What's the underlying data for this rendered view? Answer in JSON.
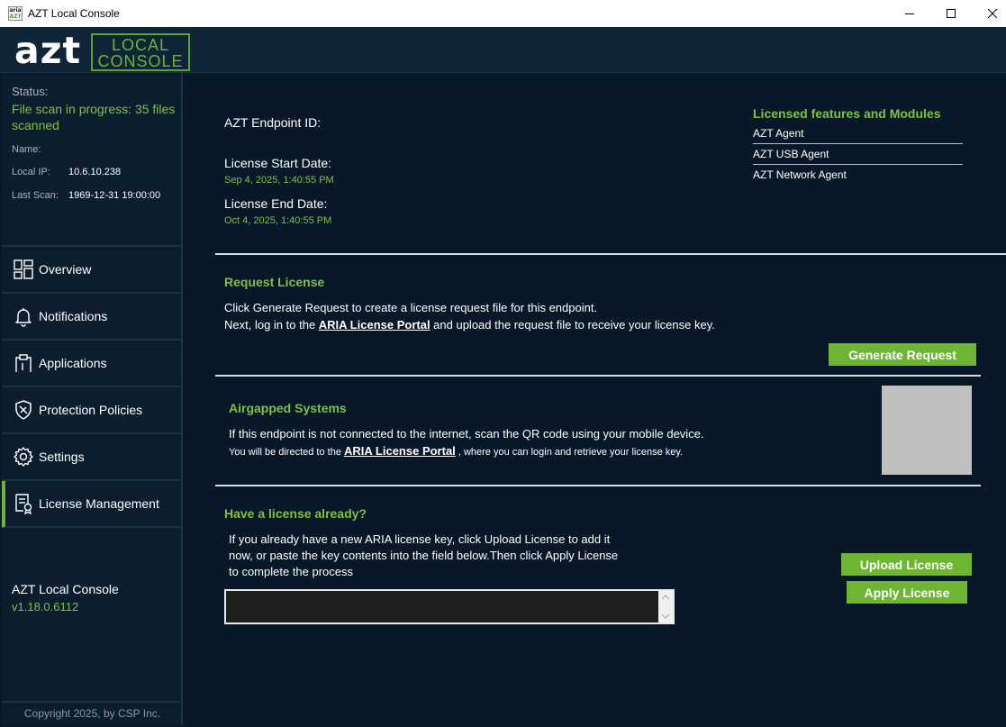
{
  "window": {
    "title": "AZT Local Console",
    "icon_text_top": "aria",
    "icon_text_bottom": "AZT"
  },
  "logo": {
    "main": "azt",
    "line1": "LOCAL",
    "line2": "CONSOLE",
    "accent_color": "#6eb534"
  },
  "status": {
    "status_label": "Status:",
    "status_text": "File scan in progress: 35 files scanned",
    "name_label": "Name:",
    "name_value": "",
    "ip_label": "Local IP:",
    "ip_value": "10.6.10.238",
    "last_scan_label": "Last Scan:",
    "last_scan_value": "1969-12-31 19:00:00"
  },
  "nav": [
    {
      "label": "Overview",
      "icon": "overview-grid-icon"
    },
    {
      "label": "Notifications",
      "icon": "bell-icon"
    },
    {
      "label": "Applications",
      "icon": "clipboard-icon"
    },
    {
      "label": "Protection Policies",
      "icon": "shield-icon"
    },
    {
      "label": "Settings",
      "icon": "gear-icon"
    },
    {
      "label": "License Management",
      "icon": "license-certificate-icon",
      "active": true
    }
  ],
  "version": {
    "name": "AZT Local Console",
    "number": "v1.18.0.6112"
  },
  "copyright": "Copyright 2025, by CSP Inc.",
  "license_info": {
    "endpoint_id_label": "AZT Endpoint ID:",
    "start_label": "License Start Date:",
    "start_value": "Sep 4, 2025, 1:40:55 PM",
    "end_label": "License End Date:",
    "end_value": "Oct 4, 2025, 1:40:55 PM"
  },
  "features": {
    "title": "Licensed features and Modules",
    "items": [
      "AZT Agent",
      "AZT USB Agent",
      "AZT Network Agent"
    ]
  },
  "request": {
    "title": "Request License",
    "line1": "Click Generate Request to create a license request file for this endpoint.",
    "line2_pre": "Next, log in to the ",
    "line2_link": "ARIA License Portal",
    "line2_post": " and upload the request file to receive your license key.",
    "button": "Generate Request"
  },
  "airgapped": {
    "title": "Airgapped Systems",
    "line1": "If this endpoint is not connected to the internet, scan the QR code using your mobile device.",
    "line2_pre": "You will be directed to the ",
    "line2_link": "ARIA License Portal",
    "line2_post": " , where you can login and retrieve your license key."
  },
  "existing": {
    "title": "Have a license already?",
    "line1": "If you already have a new ARIA license key, click Upload License to add it",
    "line2": "now, or paste the key contents into the field below.Then click Apply License",
    "line3": "to complete the process",
    "field_value": "",
    "upload_button": "Upload License",
    "apply_button": "Apply License"
  }
}
